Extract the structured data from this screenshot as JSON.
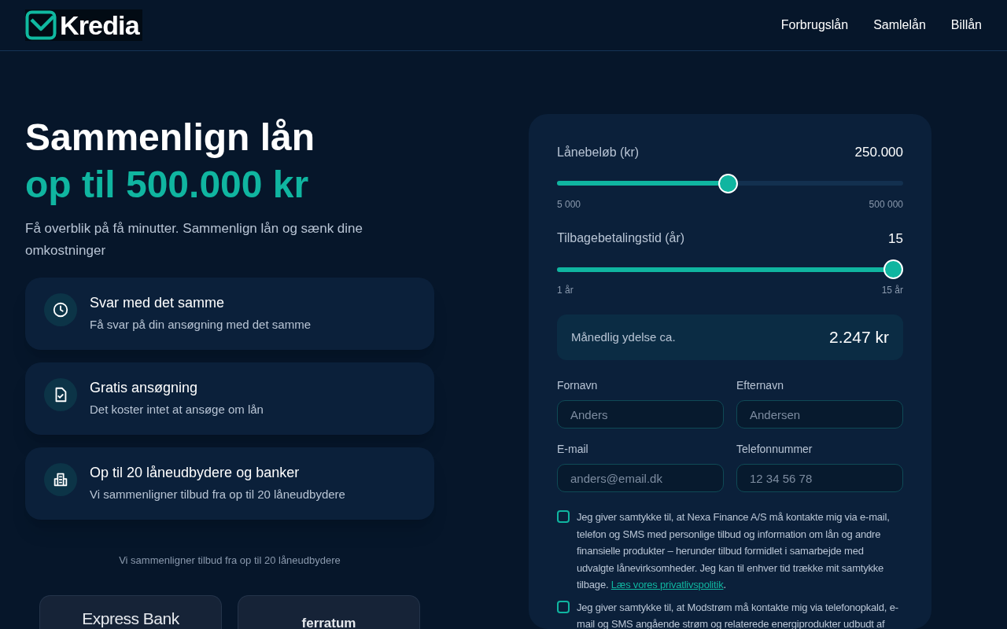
{
  "header": {
    "logo": "Kredia",
    "nav": [
      "Forbrugslån",
      "Samlelån",
      "Billån"
    ]
  },
  "hero": {
    "title": "Sammenlign lån",
    "highlight": "op til 500.000 kr",
    "subtitle": "Få overblik på få minutter. Sammenlign lån og sænk dine omkostninger"
  },
  "features": [
    {
      "kind": "clock",
      "title": "Svar med det samme",
      "text": "Få svar på din ansøgning med det samme"
    },
    {
      "kind": "document",
      "title": "Gratis ansøgning",
      "text": "Det koster intet at ansøge om lån"
    },
    {
      "kind": "building",
      "title": "Op til 20 låneudbydere og banker",
      "text": "Vi sammenligner tilbud fra op til 20 låneudbydere"
    }
  ],
  "partners": {
    "caption": "Vi sammenligner tilbud fra op til 20 låneudbydere",
    "logos": [
      "Express Bank",
      "ferratum"
    ]
  },
  "calculator": {
    "sliders": [
      {
        "label": "Lånebeløb (kr)",
        "value": "250.000",
        "level": 0.495,
        "min": "5 000",
        "max": "500 000"
      },
      {
        "label": "Tilbagebetalingstid (år)",
        "value": "15",
        "level": 1,
        "min": "1 år",
        "max": "15 år"
      }
    ],
    "monthly": {
      "label": "Månedlig ydelse ca.",
      "value": "2.247 kr"
    },
    "fields": [
      {
        "label": "Fornavn",
        "placeholder": "Anders"
      },
      {
        "label": "Efternavn",
        "placeholder": "Andersen"
      },
      {
        "label": "E-mail",
        "placeholder": "anders@email.dk"
      },
      {
        "label": "Telefonnummer",
        "placeholder": "12 34 56 78"
      }
    ],
    "consents": [
      {
        "text": "Jeg giver samtykke til, at Nexa Finance A/S må kontakte mig via e-mail, telefon og SMS med personlige tilbud og information om lån og andre finansielle produkter – herunder tilbud formidlet i samarbejde med udvalgte lånevirksomheder. Jeg kan til enhver tid trække mit samtykke tilbage.",
        "link": "Læs vores privatlivspolitik",
        "after": ".",
        "checked": false
      },
      {
        "text": "Jeg giver samtykke til, at Modstrøm må kontakte mig via telefonopkald, e-mail og SMS angående strøm og relaterede energiprodukter udbudt af",
        "checked": false
      }
    ]
  }
}
